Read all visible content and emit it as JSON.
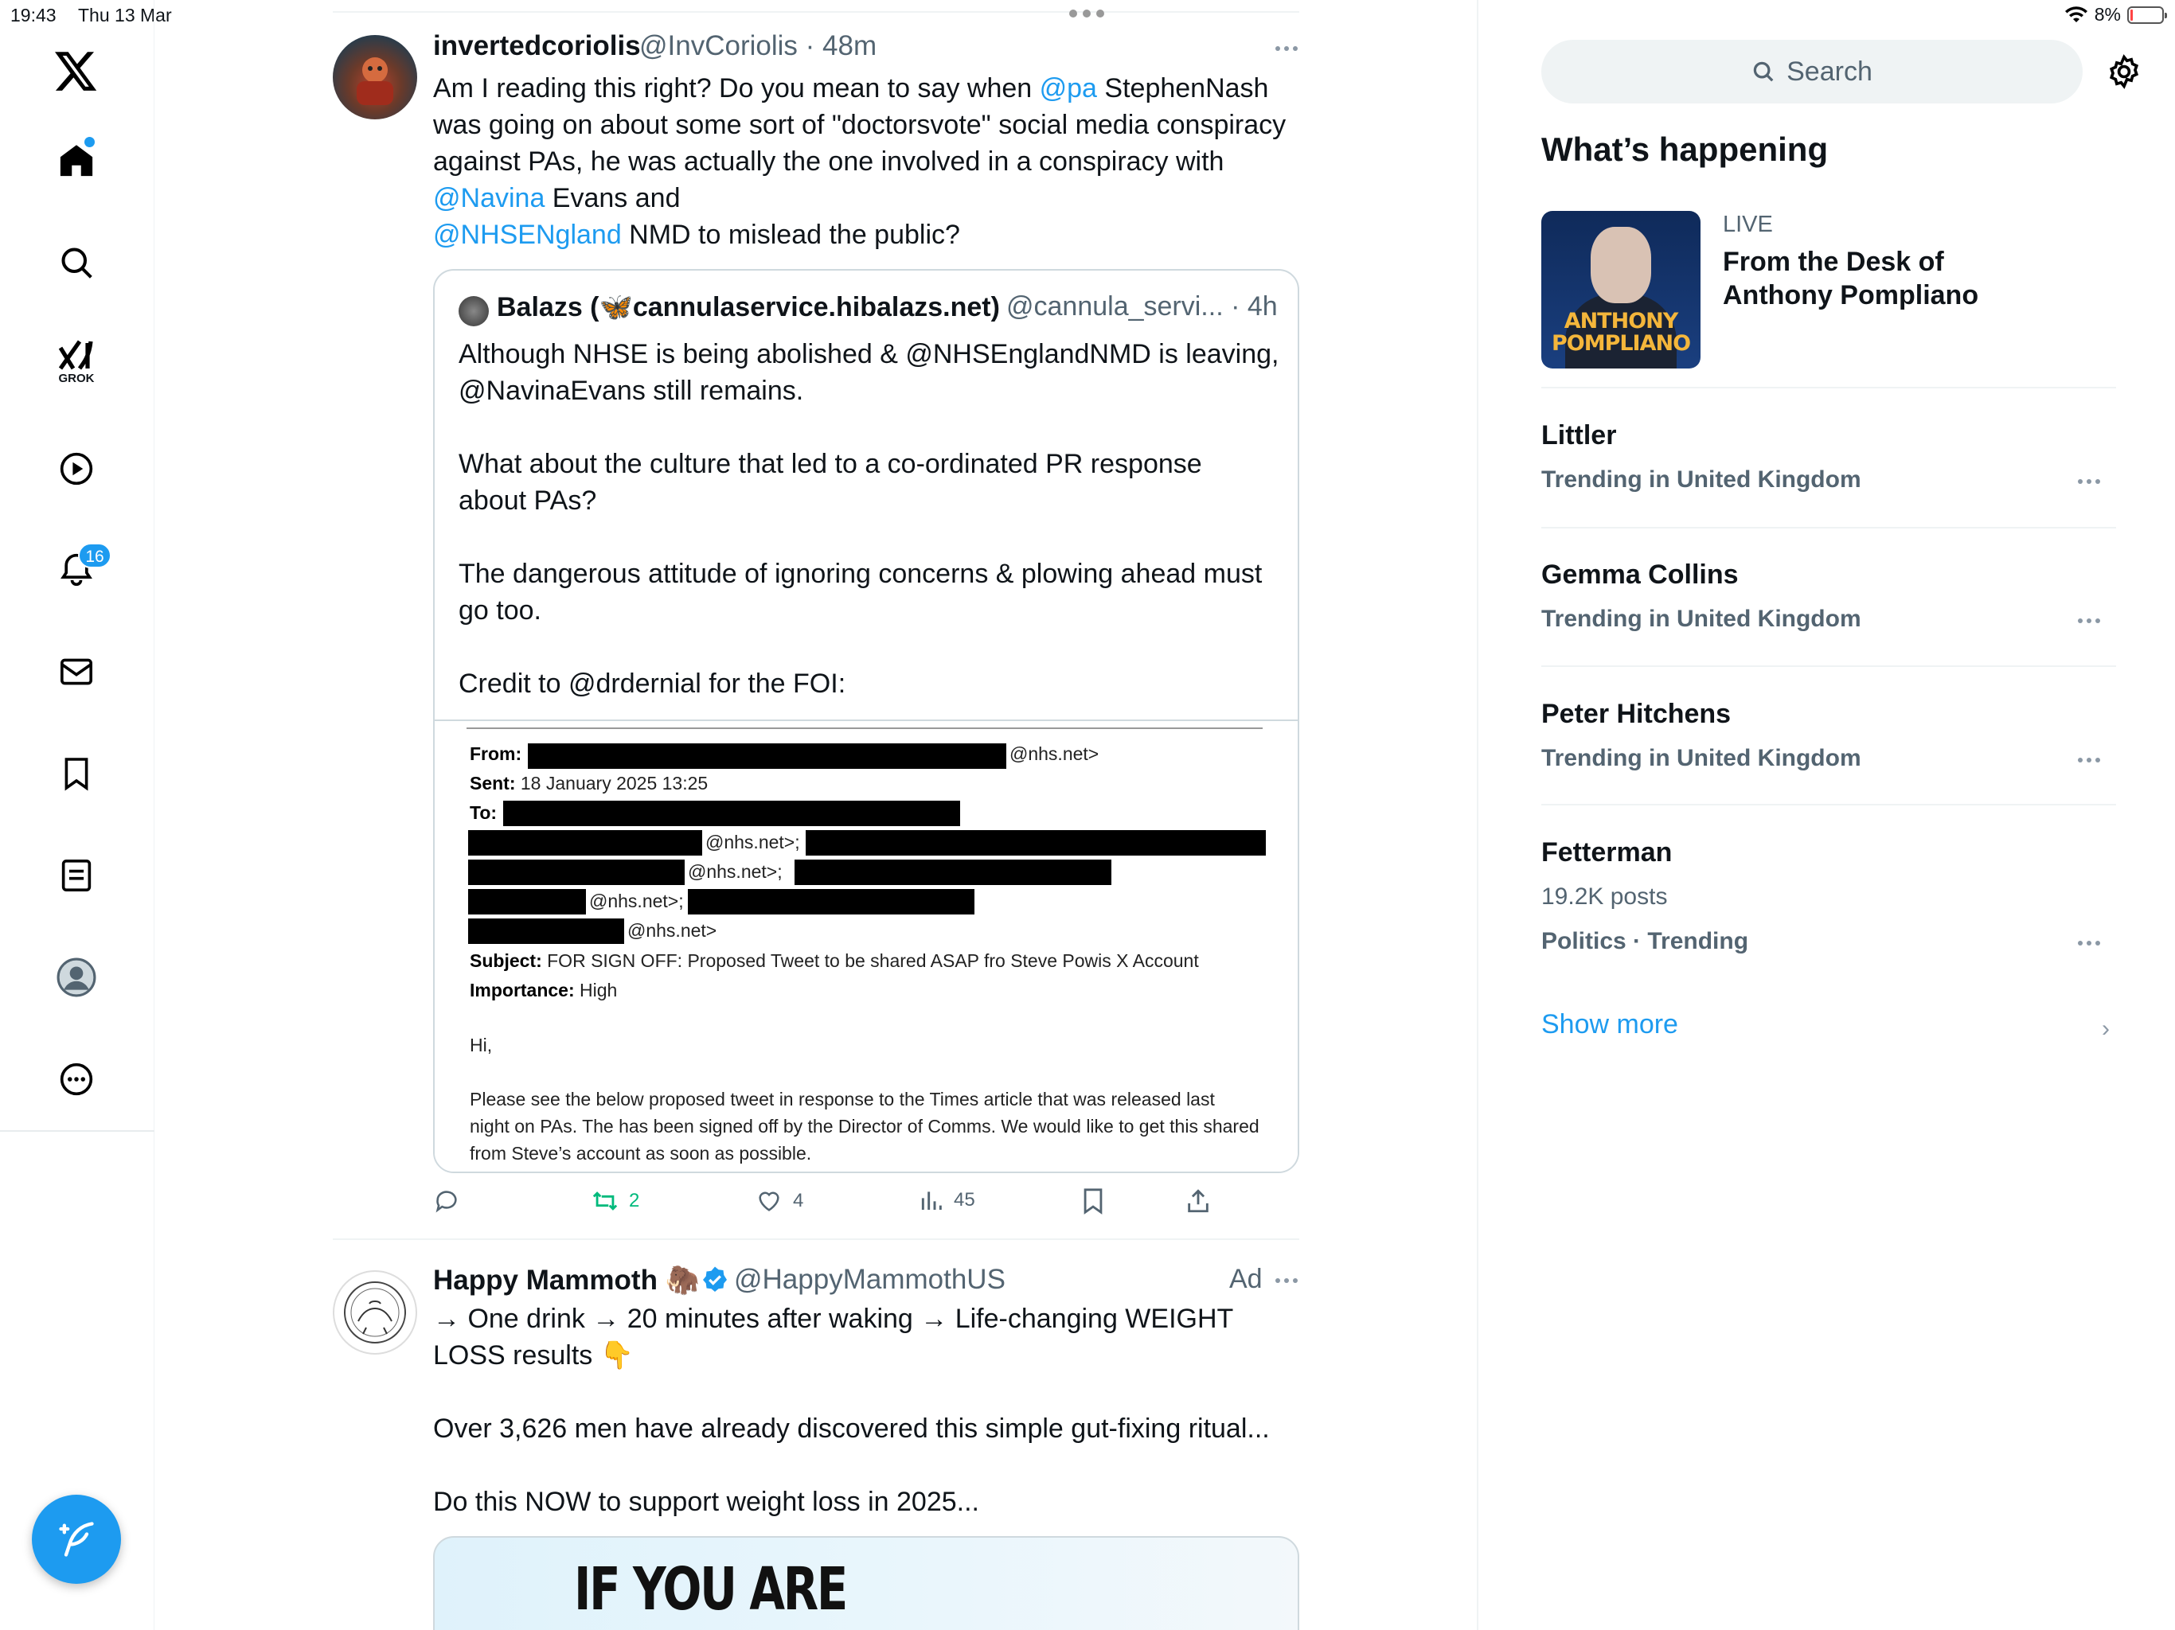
{
  "status_bar": {
    "time": "19:43",
    "date": "Thu 13 Mar",
    "battery": "8%"
  },
  "nav": {
    "notifications_count": "16",
    "grok_label": "GROK"
  },
  "tweet1": {
    "name": "invertedcoriolis",
    "handle": "@InvCoriolis",
    "time": "· 48m",
    "text_1": "Am I reading this right? Do you mean to say when ",
    "mention_pa": "@pa",
    "text_2": " StephenNash\nwas going on about some sort of \"doctorsvote\" social media conspiracy\nagainst PAs, he was actually the one involved in a conspiracy with\n",
    "mention_navina": "@Navina",
    "text_3": " Evans and\n",
    "mention_nhse": "@NHSENgland",
    "text_4": " NMD to mislead the public?",
    "quote": {
      "name": "Balazs (🦋cannulaservice.hibalazs.net)",
      "handle": "@cannula_servi... · 4h",
      "text": "Although NHSE is being abolished & @NHSEnglandNMD is leaving,\n@NavinaEvans still remains.\n\nWhat about the culture that led to a co-ordinated PR response\nabout PAs?\n\nThe dangerous attitude of ignoring concerns & plowing ahead must\ngo too.\n\nCredit to @drdernial for the FOI:",
      "email": {
        "from_label": "From:",
        "from_value": "@nhs.net>",
        "sent_label": "Sent:",
        "sent_value": "18 January 2025 13:25",
        "to_label": "To:",
        "to_line1": "@nhs.net>;",
        "to_line2": "@nhs.net>;",
        "to_line3": "@nhs.net>;",
        "to_line4": "@nhs.net>",
        "subject_label": "Subject:",
        "subject_value": "FOR SIGN OFF: Proposed Tweet to be shared ASAP fro Steve Powis X Account",
        "importance_label": "Importance:",
        "importance_value": "High",
        "greeting": "Hi,",
        "body_1": "Please see the below proposed tweet in response to the Times article that was released last",
        "body_2": "night on PAs. The has been signed off by the Director of Comms. We would like to get this shared",
        "body_3": "from Steve’s account as soon as possible."
      }
    },
    "actions": {
      "retweets": "2",
      "likes": "4",
      "views": "45"
    },
    "colors": {
      "retweet_active": "#00ba7c",
      "link": "#1d9bf0"
    }
  },
  "tweet2": {
    "name": "Happy Mammoth 🦣",
    "handle": "@HappyMammothUS",
    "ad_label": "Ad",
    "text": "→ One drink → 20 minutes after waking → Life-changing WEIGHT\nLOSS results 👇\n\nOver 3,626 men have already discovered this simple gut-fixing ritual...\n\nDo this NOW to support weight loss in 2025...",
    "image_text": "IF YOU ARE"
  },
  "sidebar": {
    "search_placeholder": "Search",
    "whats_happening": "What’s happening",
    "live_label": "LIVE",
    "live_title": "From the Desk of Anthony Pompliano",
    "live_image_text": "ANTHONY POMPLIANO",
    "trends": [
      {
        "name": "Littler",
        "context": "Trending in United Kingdom"
      },
      {
        "name": "Gemma Collins",
        "context": "Trending in United Kingdom"
      },
      {
        "name": "Peter Hitchens",
        "context": "Trending in United Kingdom"
      },
      {
        "name": "Fetterman",
        "posts": "19.2K posts",
        "context": "Politics · Trending"
      }
    ],
    "show_more": "Show more"
  }
}
